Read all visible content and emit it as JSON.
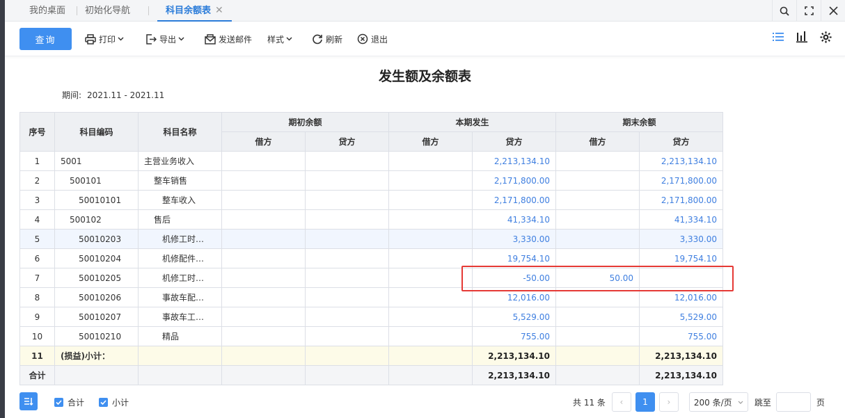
{
  "tabs": [
    {
      "label": "我的桌面"
    },
    {
      "label": "初始化导航"
    },
    {
      "label": "科目余额表",
      "close": "✕"
    }
  ],
  "toolbar": {
    "query": "查询",
    "print": "打印",
    "export": "导出",
    "send_mail": "发送邮件",
    "style": "样式",
    "refresh": "刷新",
    "exit": "退出"
  },
  "report": {
    "title": "发生额及余额表",
    "period_label": "期间:",
    "period_value": "2021.11 - 2021.11"
  },
  "table": {
    "headers": {
      "idx": "序号",
      "code": "科目编码",
      "name": "科目名称",
      "opening": "期初余额",
      "current": "本期发生",
      "closing": "期末余额",
      "debit": "借方",
      "credit": "贷方"
    },
    "rows": [
      {
        "idx": "1",
        "code": "5001",
        "name": "主营业务收入",
        "cur_credit": "2,213,134.10",
        "end_debit": "",
        "end_credit": "2,213,134.10"
      },
      {
        "idx": "2",
        "code": "500101",
        "name": "整车销售",
        "cur_credit": "2,171,800.00",
        "end_debit": "",
        "end_credit": "2,171,800.00"
      },
      {
        "idx": "3",
        "code": "50010101",
        "name": "整车收入",
        "cur_credit": "2,171,800.00",
        "end_debit": "",
        "end_credit": "2,171,800.00"
      },
      {
        "idx": "4",
        "code": "500102",
        "name": "售后",
        "cur_credit": "41,334.10",
        "end_debit": "",
        "end_credit": "41,334.10"
      },
      {
        "idx": "5",
        "code": "50010203",
        "name": "机修工时…",
        "cur_credit": "3,330.00",
        "end_debit": "",
        "end_credit": "3,330.00"
      },
      {
        "idx": "6",
        "code": "50010204",
        "name": "机修配件…",
        "cur_credit": "19,754.10",
        "end_debit": "",
        "end_credit": "19,754.10"
      },
      {
        "idx": "7",
        "code": "50010205",
        "name": "机修工时…",
        "cur_credit": "-50.00",
        "end_debit": "50.00",
        "end_credit": ""
      },
      {
        "idx": "8",
        "code": "50010206",
        "name": "事故车配…",
        "cur_credit": "12,016.00",
        "end_debit": "",
        "end_credit": "12,016.00"
      },
      {
        "idx": "9",
        "code": "50010207",
        "name": "事故车工…",
        "cur_credit": "5,529.00",
        "end_debit": "",
        "end_credit": "5,529.00"
      },
      {
        "idx": "10",
        "code": "50010210",
        "name": "精品",
        "cur_credit": "755.00",
        "end_debit": "",
        "end_credit": "755.00"
      }
    ],
    "subtotal": {
      "idx": "11",
      "label": "(损益)小计：",
      "cur_credit": "2,213,134.10",
      "end_credit": "2,213,134.10"
    },
    "total": {
      "label": "合计",
      "cur_credit": "2,213,134.10",
      "end_credit": "2,213,134.10"
    }
  },
  "footer": {
    "chk_total": "合计",
    "chk_subtotal": "小计",
    "count": "共 11 条",
    "prev": "‹",
    "page": "1",
    "next": "›",
    "page_size": "200 条/页",
    "goto": "跳至",
    "page_unit": "页"
  },
  "colors": {
    "accent": "#3f8ff0",
    "highlight": "#e53935",
    "number": "#3f7fe0"
  }
}
